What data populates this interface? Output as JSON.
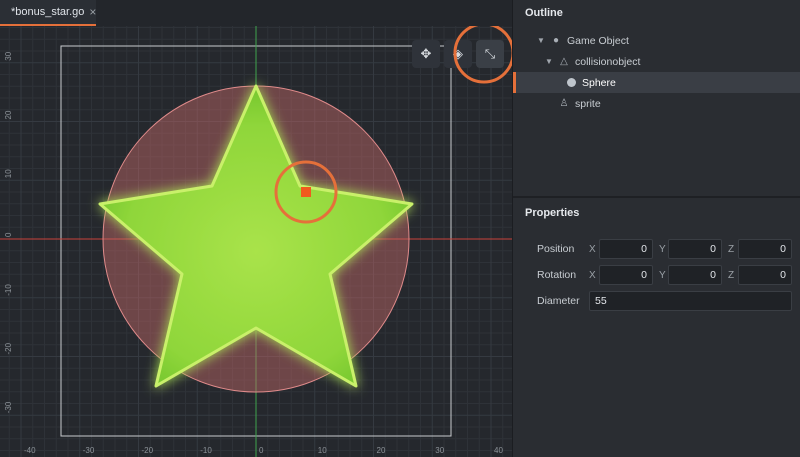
{
  "editor": {
    "tab": {
      "title": "*bonus_star.go",
      "close": "×"
    },
    "ruler": {
      "x_ticks": [
        "-40",
        "-30",
        "-20",
        "-10",
        "0",
        "10",
        "20",
        "30",
        "40"
      ],
      "y_ticks": [
        "30",
        "20",
        "10",
        "0",
        "-10",
        "-20",
        "-30"
      ]
    },
    "toolbar": [
      {
        "name": "move-tool-button",
        "glyph": "✥"
      },
      {
        "name": "rotate-tool-button",
        "glyph": "◈"
      },
      {
        "name": "scale-tool-button",
        "glyph": "⤡"
      }
    ],
    "colors": {
      "accent": "#e5703a",
      "collision": "#c86b6b",
      "star": "#8fd63a",
      "axis_x": "#c9423a",
      "axis_y": "#3fa34d"
    }
  },
  "outline": {
    "title": "Outline",
    "items": [
      {
        "label": "Game Object",
        "icon": "game-object-icon",
        "depth": 0,
        "caret": "▼"
      },
      {
        "label": "collisionobject",
        "icon": "collision-icon",
        "depth": 1,
        "caret": "▼"
      },
      {
        "label": "Sphere",
        "icon": "sphere-icon",
        "depth": 2,
        "caret": ""
      },
      {
        "label": "sprite",
        "icon": "sprite-icon",
        "depth": 1,
        "caret": ""
      }
    ]
  },
  "properties": {
    "title": "Properties",
    "position": {
      "label": "Position",
      "x": "0",
      "y": "0",
      "z": "0"
    },
    "rotation": {
      "label": "Rotation",
      "x": "0",
      "y": "0",
      "z": "0"
    },
    "diameter": {
      "label": "Diameter",
      "value": "55"
    },
    "axes": {
      "x": "X",
      "y": "Y",
      "z": "Z"
    }
  }
}
